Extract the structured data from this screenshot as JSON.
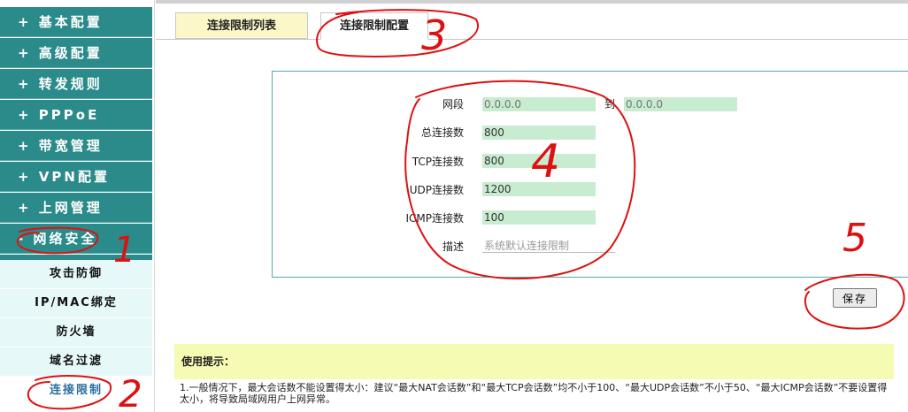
{
  "sidebar": {
    "main_items": [
      {
        "label": "+ 基本配置"
      },
      {
        "label": "+ 高级配置"
      },
      {
        "label": "+ 转发规则"
      },
      {
        "label": "+ PPPoE"
      },
      {
        "label": "+ 带宽管理"
      },
      {
        "label": "+ VPN配置"
      },
      {
        "label": "+ 上网管理"
      },
      {
        "label": "- 网络安全"
      }
    ],
    "sub_items": [
      {
        "label": "攻击防御"
      },
      {
        "label": "IP/MAC绑定"
      },
      {
        "label": "防火墙"
      },
      {
        "label": "域名过滤"
      },
      {
        "label": "连接限制"
      }
    ]
  },
  "tabs": {
    "list_label": "连接限制列表",
    "config_label": "连接限制配置"
  },
  "form": {
    "segment_label": "网段",
    "segment_start": "0.0.0.0",
    "to_label": "到",
    "segment_end": "0.0.0.0",
    "total_label": "总连接数",
    "total_value": "800",
    "tcp_label": "TCP连接数",
    "tcp_value": "800",
    "udp_label": "UDP连接数",
    "udp_value": "1200",
    "icmp_label": "ICMP连接数",
    "icmp_value": "100",
    "desc_label": "描述",
    "desc_value": "系统默认连接限制"
  },
  "save_label": "保存",
  "tips": {
    "title": "使用提示：",
    "text": "1.一般情况下，最大会话数不能设置得太小：建议“最大NAT会话数”和“最大TCP会话数”均不小于100、“最大UDP会话数”不小于50、“最大ICMP会话数”不要设置得太小，将导致局域网用户上网异常。"
  },
  "annotations": {
    "n1": "1",
    "n2": "2",
    "n3": "3",
    "n4": "4",
    "n5": "5"
  },
  "colors": {
    "sidebar": "#2b8a8a",
    "sub_bg": "#e6f8f8",
    "field_bg": "#c8ecd0",
    "tip_bg": "#f6fbb4",
    "annotation": "#dd1111"
  }
}
